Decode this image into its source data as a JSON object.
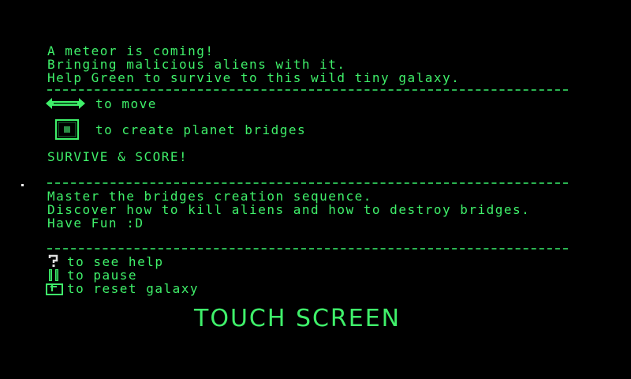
{
  "intro": {
    "line1": "A meteor is coming!",
    "line2": "Bringing malicious aliens with it.",
    "line3": "Help Green to survive to this wild tiny galaxy."
  },
  "controls": {
    "move_text": "to move",
    "move_icon": "left-right-arrows-icon",
    "bridge_text": "to create planet bridges",
    "bridge_icon": "square-button-icon"
  },
  "goal": "SURVIVE & SCORE!",
  "tips": {
    "line1": "Master the bridges creation sequence.",
    "line2": "Discover how to kill aliens and how to destroy bridges.",
    "line3": "Have Fun :D"
  },
  "buttons": {
    "help_text": "to see help",
    "help_icon": "question-mark-icon",
    "pause_text": "to pause",
    "pause_icon": "pause-icon",
    "reset_text": "to reset galaxy",
    "reset_icon": "reset-icon"
  },
  "touch_label": "TOUCH SCREEN",
  "colors": {
    "background": "#000000",
    "text": "#3ff06a"
  }
}
